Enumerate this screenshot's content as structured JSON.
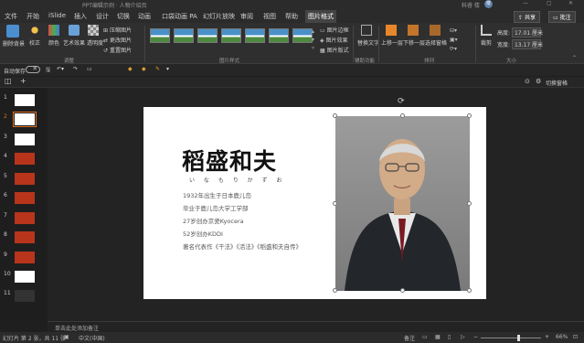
{
  "titlebar": {
    "title": "PPT编辑示例 · 人物介绍页",
    "user": "科睿 楼",
    "user_initial": "楼"
  },
  "tabs": [
    "文件",
    "开始",
    "iSlide",
    "插入",
    "设计",
    "切换",
    "动画",
    "口袋动画 PA",
    "幻灯片放映",
    "审阅",
    "视图",
    "帮助",
    "图片格式"
  ],
  "share_label": "共享",
  "comment_label": "批注",
  "ribbon": {
    "remove_bg": "删除背景",
    "corrections": "校正",
    "color": "颜色",
    "artistic": "艺术效果",
    "transparency": "透明度",
    "compress": "压缩图片",
    "change": "更改图片",
    "reset": "重置图片",
    "adjust_group": "调整",
    "styles_group": "图片样式",
    "border": "图片边框",
    "effects": "图片效果",
    "layout": "图片版式",
    "alt_text": "替换文字",
    "access_group": "辅助功能",
    "forward": "上移一层",
    "backward": "下移一层",
    "selection": "选择窗格",
    "arrange_group": "排列",
    "crop": "裁剪",
    "height_label": "高度:",
    "height_value": "17.01 厘米",
    "width_label": "宽度:",
    "width_value": "13.17 厘米",
    "size_group": "大小"
  },
  "qat": {
    "autosave": "自动保存",
    "autosave_state": "关"
  },
  "workbar": {
    "pane_label": "切换窗格"
  },
  "thumbnails": [
    "1",
    "2",
    "3",
    "4",
    "5",
    "6",
    "7",
    "8",
    "9",
    "10",
    "11"
  ],
  "slide": {
    "name": "稻盛和夫",
    "ruby": "い な も り か ず お",
    "lines": [
      "1932年出生于日本鹿儿岛",
      "毕业于鹿儿岛大学工学部",
      "27岁创办京瓷Kyocera",
      "52岁创办KDDI",
      "著名代表作《干法》《活法》《稻盛和夫自传》"
    ]
  },
  "notes_placeholder": "单击此处添加备注",
  "status": {
    "slide_info": "幻灯片 第 2 张，共 11 张",
    "language": "中文(中国)",
    "notes": "备注",
    "zoom": "66%"
  },
  "colors": {
    "accent": "#e07020",
    "slide_red": "#b8351c",
    "ribbon_bg": "#2f2f2f"
  }
}
